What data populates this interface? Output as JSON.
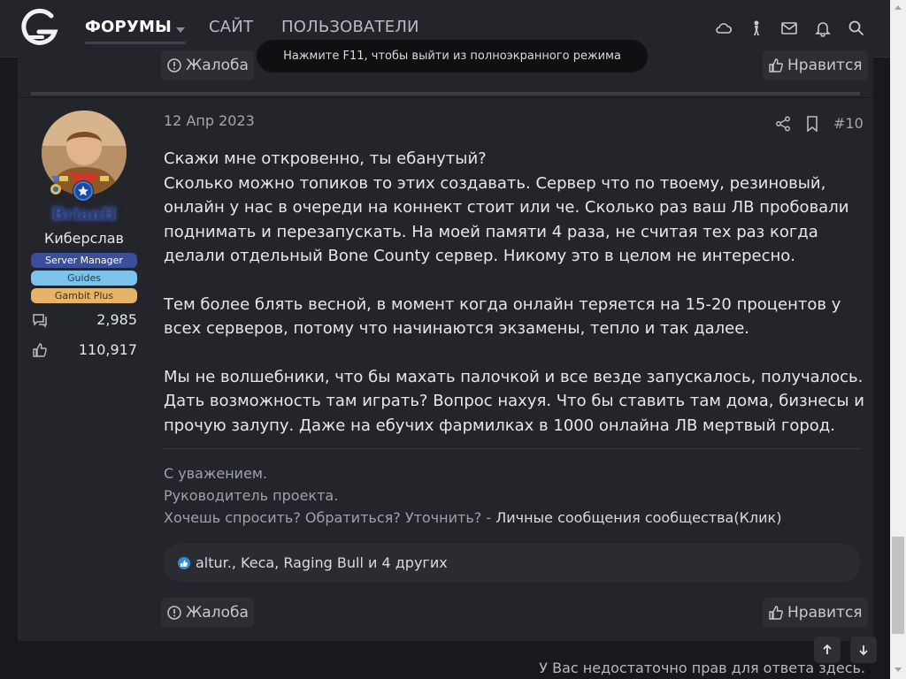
{
  "nav": {
    "forums": "ФОРУМЫ",
    "site": "САЙТ",
    "users": "ПОЛЬЗОВАТЕЛИ"
  },
  "fullscreen_hint": "Нажмите F11, чтобы выйти из полноэкранного режима",
  "prev_post": {
    "report_label": "Жалоба",
    "like_label": "Нравится"
  },
  "post": {
    "date": "12 Апр 2023",
    "number": "#10",
    "author": {
      "name": "BrianH",
      "title": "Киберслав",
      "badges": [
        {
          "label": "Server Manager",
          "bg": "#3b4e9a",
          "fg": "#ffffff"
        },
        {
          "label": "Guides",
          "bg": "#7cc2ea",
          "fg": "#1d3b50"
        },
        {
          "label": "Gambit Plus",
          "bg": "#e6b36a",
          "fg": "#4a3212"
        }
      ],
      "messages": "2,985",
      "reactions": "110,917"
    },
    "body": [
      "Скажи мне откровенно, ты ебанутый?\nСколько можно топиков то этих создавать. Сервер что по твоему, резиновый, онлайн у нас в очереди на коннект стоит или че. Сколько раз ваш ЛВ пробовали поднимать и перезапускать. На моей памяти 4 раза, не считая тех раз когда делали отдельный Bone County сервер. Никому это в целом не интересно.",
      "Тем более блять весной, в момент когда онлайн теряется на 15-20 процентов у всех серверов, потому что начинаются экзамены, тепло и так далее.",
      "Мы не волшебники, что бы махать палочкой и все везде запускалось, получалось. Дать возможность там играть? Вопрос нахуя. Что бы ставить там дома, бизнесы и прочую залупу. Даже на ебучих фармилках в 1000 онлайна ЛВ мертвый город."
    ],
    "signature": {
      "line1": "С уважением.",
      "line2": "Руководитель проекта.",
      "line3_prefix": "Хочешь спросить? Обратиться? Уточнить? - ",
      "line3_link": "Личные сообщения сообщества(Клик)"
    },
    "reactions_text": "altur., Keca, Raging Bull и 4 других",
    "report_label": "Жалоба",
    "like_label": "Нравится"
  },
  "footer": {
    "no_rights": "У Вас недостаточно прав для ответа здесь."
  },
  "colors": {
    "background": "#18191d",
    "panel": "#23252a",
    "accent_blue": "#2e8ce0"
  }
}
